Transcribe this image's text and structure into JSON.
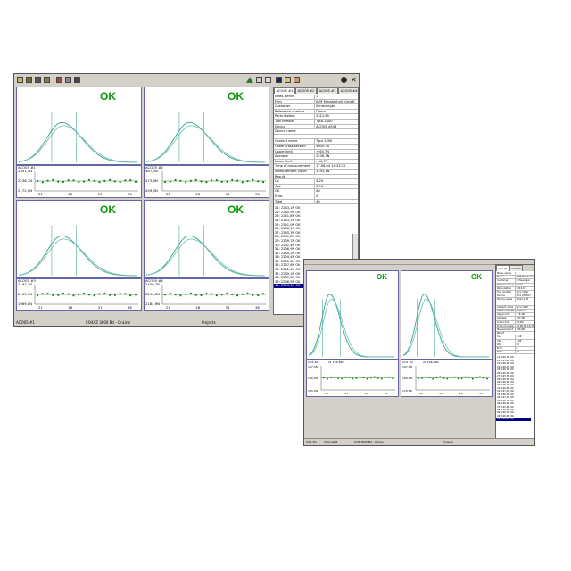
{
  "main": {
    "status": {
      "left": "ACO05 #1",
      "mid": "CO4AZ 3600 Bd - OnLine",
      "right": "Projects"
    },
    "tabs": [
      "ACO05 #1",
      "ACO05 #2",
      "ACO05 #3",
      "ACO05 #4"
    ],
    "props": [
      [
        "Meas. series",
        "1"
      ],
      [
        "Firm",
        "KMF Messtechnik GmbH"
      ],
      [
        "Customer",
        "Schleuniger"
      ],
      [
        "Reference number",
        "Demo"
      ],
      [
        "Parts station",
        "2312.60"
      ],
      [
        "Tool number",
        "Tyco-1400"
      ],
      [
        "Device",
        "ACO05_a543"
      ],
      [
        "Device name",
        ""
      ],
      [
        "",
        ""
      ],
      [
        "Contact name",
        "Tyco 1400"
      ],
      [
        "Cable cross section",
        "4m/0.30"
      ],
      [
        "Upper limit",
        "+ 64,7N"
      ],
      [
        "Average",
        "2236,7N"
      ],
      [
        "Lower limit",
        "- 64,7N"
      ],
      [
        "Time of measurement",
        "17.06.04 14:33:12"
      ],
      [
        "Measurement value",
        "2243,1N"
      ],
      [
        "Result",
        ""
      ],
      [
        "Cp",
        "4,29"
      ],
      [
        "Cpk",
        "3,94"
      ],
      [
        "OK",
        "40"
      ],
      [
        "Error",
        "0"
      ],
      [
        "Total",
        "40"
      ]
    ],
    "list": [
      "21: 2243,1N  OK",
      "22: 2250,9N  OK",
      "23: 2241,8N  OK",
      "24: 2243,1N  OK",
      "25: 2241,0N  OK",
      "26: 2238,1N  OK",
      "27: 2245,3N  OK",
      "28: 2241,8N  OK",
      "29: 2239,7N  OK",
      "30: 2232,4N  OK",
      "31: 2236,9N  OK",
      "32: 2240,2N  OK",
      "33: 2234,4N  OK",
      "34: 2231,8N  OK",
      "35: 2237,6N  OK",
      "36: 2232,4N  OK",
      "37: 2239,1N  OK",
      "38: 2235,8N  OK",
      "39: 2236,9N  OK",
      "40: 2243,1N  OK"
    ],
    "panels": [
      {
        "ok": "OK",
        "name": "ACO05 #1",
        "yticks": [
          "2301,4N",
          "2236,7N",
          "2172,0N"
        ],
        "xticks": [
          "21",
          "26",
          "31",
          "36"
        ]
      },
      {
        "ok": "OK",
        "name": "ACO05 #2",
        "yticks": [
          "487,3N",
          "473,9N",
          "459,3N"
        ],
        "xticks": [
          "21",
          "26",
          "31",
          "36"
        ]
      },
      {
        "ok": "OK",
        "name": "ACO05 #3",
        "yticks": [
          "2197,3N",
          "2103,7N",
          "1969,0N"
        ],
        "xticks": [
          "21",
          "26",
          "31",
          "36"
        ]
      },
      {
        "ok": "OK",
        "name": "ACO05 #4",
        "yticks": [
          "2406,7N",
          "2296,8N",
          "2184,9N"
        ],
        "xticks": [
          "21",
          "26",
          "31",
          "36"
        ]
      }
    ]
  },
  "second": {
    "status": {
      "left": "CO1-#1",
      "a": "Channel B",
      "mid": "CO4 3600 Bd - Online",
      "right": "Projects"
    },
    "tabs": [
      "CO1 #1",
      "CO1 #2"
    ],
    "props": [
      [
        "Meas. series",
        "1"
      ],
      [
        "Firm",
        "KMF Messtechnik GmbH"
      ],
      [
        "Customer",
        "Schleuniger"
      ],
      [
        "Reference number",
        "Demo"
      ],
      [
        "Parts station",
        "2312.60"
      ],
      [
        "Tool number",
        "Tyco 1400"
      ],
      [
        "Device",
        "CO1 075627"
      ],
      [
        "Device name",
        "Channel B"
      ],
      [
        "",
        ""
      ],
      [
        "Contact name",
        "Tyco 1400"
      ],
      [
        "Cable cross section",
        "4m/0.30"
      ],
      [
        "Upper limit",
        "+ 8,4N"
      ],
      [
        "Average",
        "197,3N"
      ],
      [
        "Lower limit",
        "- 8,4N"
      ],
      [
        "Time of measurement",
        "29.06.04 14:33:26"
      ],
      [
        "Measurement value",
        "196,9N"
      ],
      [
        "Result",
        ""
      ],
      [
        "Cp",
        "3,19"
      ],
      [
        "Cpk",
        "3,04"
      ],
      [
        "OK",
        "26"
      ],
      [
        "Error",
        "0"
      ],
      [
        "Total",
        "26"
      ]
    ],
    "list": [
      "21: 196,9N  OK",
      "22: 195,6N  OK",
      "23: 196,9N  OK",
      "24: 196,1N  OK",
      "25: 196,0N  OK",
      "26: 196,9N  OK",
      "27: 197,3N  OK",
      "28: 196,5N  OK",
      "29: 196,9N  OK",
      "30: 195,2N  OK",
      "31: 196,8N  OK",
      "32: 197,2N  OK",
      "33: 196,5N  OK",
      "34: 197,1N  OK",
      "35: 196,4N  OK",
      "36: 196,9N  OK",
      "37: 195,8N  OK",
      "38: 196,6N  OK",
      "39: 196,3N  OK",
      "40: 196,9N  OK",
      "41: 196,2N  OK"
    ],
    "panels": [
      {
        "ok": "OK",
        "name": "CO1 #1",
        "sub": "21  194,84N",
        "yticks": [
          "197,3N",
          "196,3N",
          "195,3N"
        ],
        "xticks": [
          "16",
          "21",
          "26",
          "31"
        ]
      },
      {
        "ok": "OK",
        "name": "CO1 #2",
        "sub": "21  196,89N",
        "yticks": [
          "197,3N",
          "196,3N",
          "176,3N"
        ],
        "xticks": [
          "16",
          "21",
          "26",
          "31"
        ]
      }
    ]
  }
}
